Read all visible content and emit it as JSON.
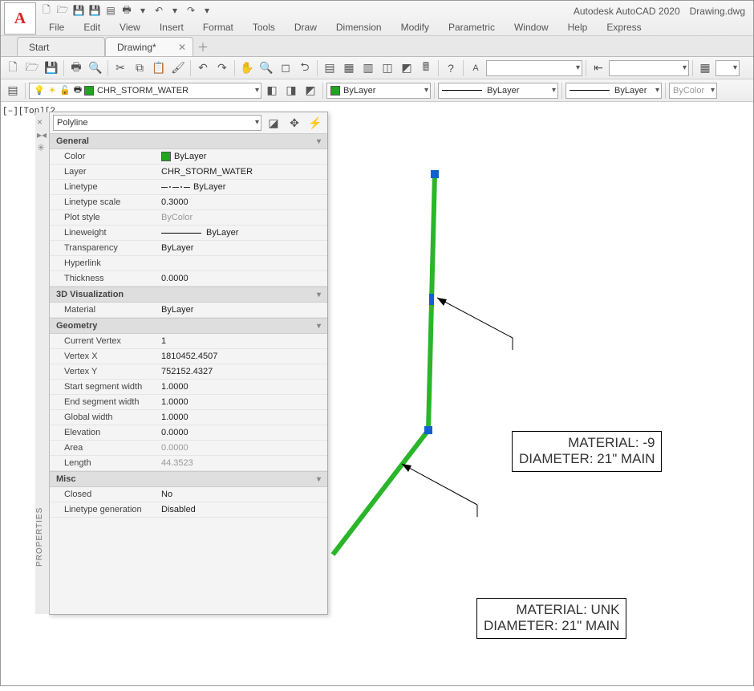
{
  "title": {
    "app": "Autodesk AutoCAD 2020",
    "doc": "Drawing.dwg"
  },
  "menu": [
    "File",
    "Edit",
    "View",
    "Insert",
    "Format",
    "Tools",
    "Draw",
    "Dimension",
    "Modify",
    "Parametric",
    "Window",
    "Help",
    "Express"
  ],
  "tabs": {
    "start": "Start",
    "active": "Drawing*"
  },
  "layer_combo": "CHR_STORM_WATER",
  "color_combo": "ByLayer",
  "ltype_combo": "ByLayer",
  "lweight_combo": "ByLayer",
  "bycolor_combo": "ByColor",
  "view_label": "[–][Top][2",
  "props": {
    "title": "PROPERTIES",
    "object_type": "Polyline",
    "sections": {
      "general": {
        "head": "General",
        "color": {
          "k": "Color",
          "v": "ByLayer"
        },
        "layer": {
          "k": "Layer",
          "v": "CHR_STORM_WATER"
        },
        "linetype": {
          "k": "Linetype",
          "v": "ByLayer"
        },
        "ltscale": {
          "k": "Linetype scale",
          "v": "0.3000"
        },
        "plotstyle": {
          "k": "Plot style",
          "v": "ByColor"
        },
        "lineweight": {
          "k": "Lineweight",
          "v": "ByLayer"
        },
        "transparency": {
          "k": "Transparency",
          "v": "ByLayer"
        },
        "hyperlink": {
          "k": "Hyperlink",
          "v": ""
        },
        "thickness": {
          "k": "Thickness",
          "v": "0.0000"
        }
      },
      "viz": {
        "head": "3D Visualization",
        "material": {
          "k": "Material",
          "v": "ByLayer"
        }
      },
      "geom": {
        "head": "Geometry",
        "cur_vertex": {
          "k": "Current Vertex",
          "v": "1"
        },
        "vx": {
          "k": "Vertex X",
          "v": "1810452.4507"
        },
        "vy": {
          "k": "Vertex Y",
          "v": "752152.4327"
        },
        "sw": {
          "k": "Start segment width",
          "v": "1.0000"
        },
        "ew": {
          "k": "End segment width",
          "v": "1.0000"
        },
        "gw": {
          "k": "Global width",
          "v": "1.0000"
        },
        "elev": {
          "k": "Elevation",
          "v": "0.0000"
        },
        "area": {
          "k": "Area",
          "v": "0.0000"
        },
        "length": {
          "k": "Length",
          "v": "44.3523"
        }
      },
      "misc": {
        "head": "Misc",
        "closed": {
          "k": "Closed",
          "v": "No"
        },
        "ltgen": {
          "k": "Linetype generation",
          "v": "Disabled"
        }
      }
    }
  },
  "callouts": {
    "c1": {
      "l1": "MATERIAL: -9",
      "l2": "DIAMETER: 21\" MAIN"
    },
    "c2": {
      "l1": "MATERIAL: UNK",
      "l2": "DIAMETER: 21\" MAIN"
    }
  }
}
